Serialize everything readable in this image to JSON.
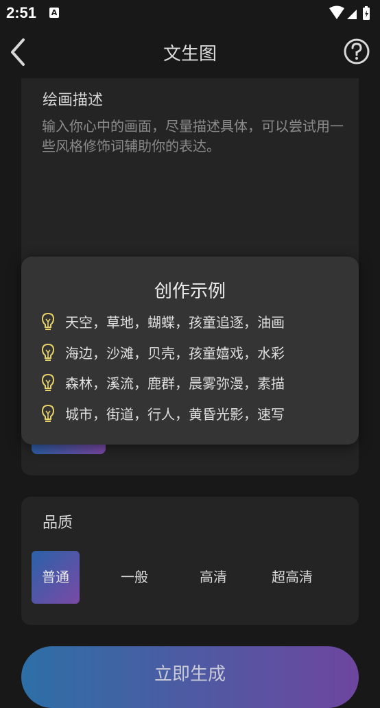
{
  "status_bar": {
    "time": "2:51",
    "notification_letter": "A"
  },
  "app_bar": {
    "title": "文生图"
  },
  "description": {
    "title": "绘画描述",
    "placeholder": "输入你心中的画面，尽量描述具体，可以尝试用一些风格修饰词辅助你的表达。"
  },
  "examples_popup": {
    "title": "创作示例",
    "items": [
      "天空，草地，蝴蝶，孩童追逐，油画",
      "海边，沙滩，贝壳，孩童嬉戏，水彩",
      "森林，溪流，鹿群，晨雾弥漫，素描",
      "城市，街道，行人，黄昏光影，速写"
    ]
  },
  "quality": {
    "title": "品质",
    "options": [
      "普通",
      "一般",
      "高清",
      "超高清"
    ],
    "selected": "普通"
  },
  "generate_button": {
    "label": "立即生成"
  },
  "colors": {
    "background": "#181818",
    "card": "#242424",
    "popup": "#343434",
    "gradient_start": "#2d6fa6",
    "gradient_end": "#7c4aa8",
    "bulb": "#e8d36a"
  }
}
